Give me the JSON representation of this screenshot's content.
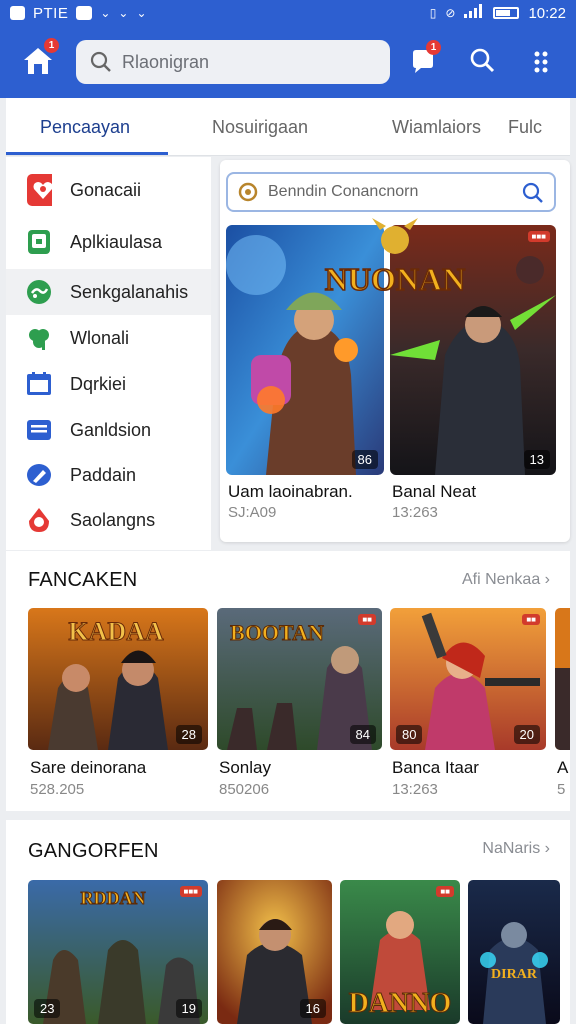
{
  "status_bar": {
    "left_label": "PTIE",
    "time": "10:22"
  },
  "app_bar": {
    "home_badge": "1",
    "search_placeholder": "Rlaonigran",
    "notif_badge": "1"
  },
  "tabs": [
    {
      "label": "Pencaayan"
    },
    {
      "label": "Nosuirigaan"
    },
    {
      "label": "Wiamlaiors"
    },
    {
      "label": "Fulc"
    }
  ],
  "sidebar": {
    "items": [
      {
        "label": "Gonacaii",
        "icon": "gamepad-heart-icon",
        "color": "#e53935"
      },
      {
        "label": "Aplkiaulasa",
        "icon": "phone-app-icon",
        "color": "#2e9e4f"
      },
      {
        "label": "Senkgalanahis",
        "icon": "globe-icon",
        "color": "#2e9e4f"
      },
      {
        "label": "Wlonali",
        "icon": "clover-icon",
        "color": "#2e9e4f"
      },
      {
        "label": "Dqrkiei",
        "icon": "calendar-icon",
        "color": "#2d5fd0"
      },
      {
        "label": "Ganldsion",
        "icon": "document-icon",
        "color": "#2d5fd0"
      },
      {
        "label": "Paddain",
        "icon": "pen-icon",
        "color": "#2d5fd0"
      },
      {
        "label": "Saolangns",
        "icon": "drop-icon",
        "color": "#e53935"
      }
    ]
  },
  "featured": {
    "search_placeholder": "Benndin Conancnorn",
    "banner_text": "NUONAN",
    "cards": [
      {
        "title": "Uam laoinabran.",
        "meta": "SJ:A09",
        "badge": "86"
      },
      {
        "title": "Banal Neat",
        "meta": "13:263",
        "badge": "13"
      }
    ]
  },
  "section1": {
    "heading": "FANCAKEN",
    "link": "Afi Nenkaa",
    "cards": [
      {
        "title": "Sare deinorana",
        "meta": "528.205",
        "badge": "28",
        "art": "KADAA"
      },
      {
        "title": "Sonlay",
        "meta": "850206",
        "badge": "84",
        "art": "BOOTAN"
      },
      {
        "title": "Banca Itaar",
        "meta": "13:263",
        "badge": "80",
        "badge2": "20"
      },
      {
        "title": "A",
        "meta": "5"
      }
    ]
  },
  "section2": {
    "heading": "GANGORFEN",
    "link": "NaNaris",
    "cards": [
      {
        "badge": "23",
        "badge2": "19",
        "art": "RDDAN"
      },
      {
        "badge": "16"
      },
      {
        "art": "DANNO"
      },
      {
        "art": "DIRAR"
      }
    ]
  },
  "colors": {
    "primary": "#2d5fd0",
    "badge_red": "#e53935"
  }
}
